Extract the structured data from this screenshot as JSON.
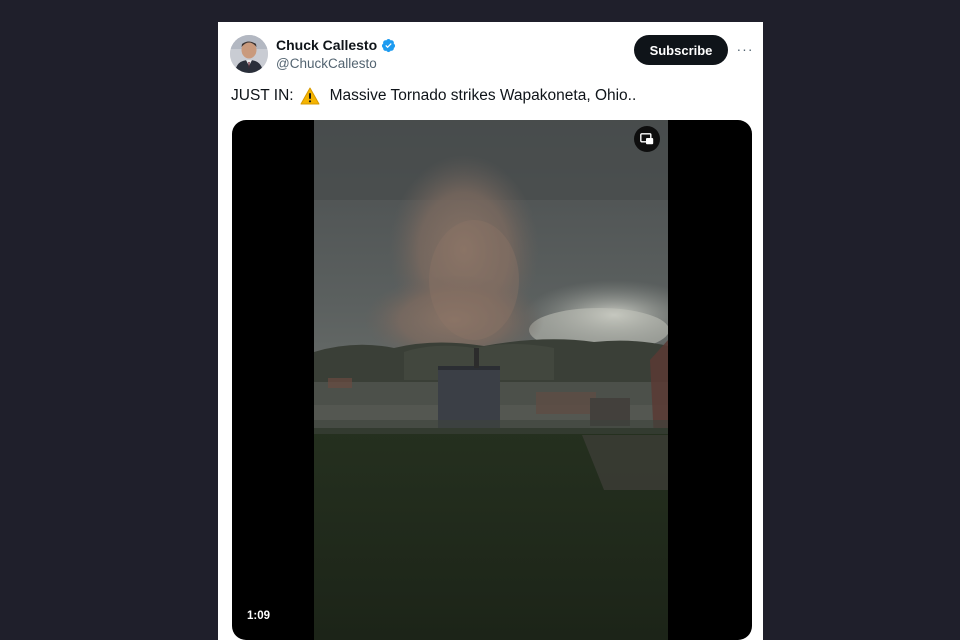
{
  "tweet": {
    "author": {
      "display_name": "Chuck Callesto",
      "handle": "@ChuckCallesto",
      "verified": true
    },
    "subscribe_label": "Subscribe",
    "more_label": "···",
    "text_prefix": "JUST IN:",
    "text_emoji": "warning-emoji",
    "text_body": "Massive Tornado strikes Wapakoneta, Ohio..",
    "media": {
      "type": "video",
      "duration": "1:09",
      "pip_icon": "picture-in-picture-icon"
    }
  },
  "colors": {
    "page_background": "#1f1f2b",
    "card_background": "#ffffff",
    "verified_blue": "#1d9bf0",
    "subscribe_button": "#0f1419",
    "handle_gray": "#536471"
  }
}
